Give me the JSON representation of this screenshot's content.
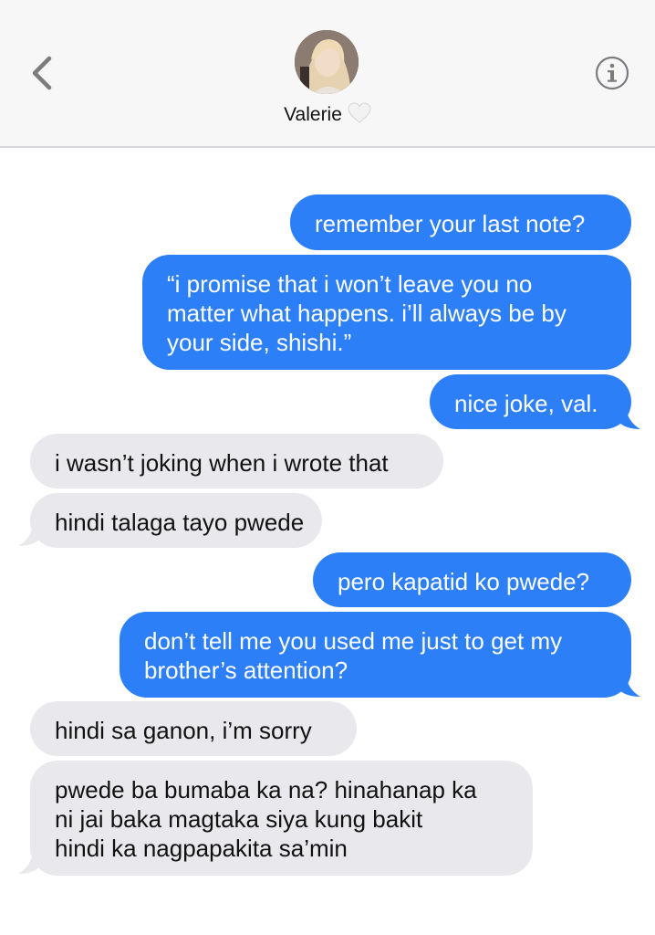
{
  "header": {
    "contact_name": "Valerie",
    "back_icon": "chevron-left-icon",
    "info_icon": "info-icon",
    "heart_icon": "white-heart-icon"
  },
  "colors": {
    "sent_bubble": "#2d7ff7",
    "received_bubble": "#e9e9ed",
    "accent": "#2d7ff7"
  },
  "messages": [
    {
      "direction": "sent",
      "lines": [
        "remember your last note?"
      ]
    },
    {
      "direction": "sent",
      "lines": [
        "“i promise that i won’t leave you no",
        "matter what happens. i’ll always be by",
        "your side, shishi.”"
      ]
    },
    {
      "direction": "sent",
      "lines": [
        "nice joke, val."
      ]
    },
    {
      "direction": "received",
      "lines": [
        "i wasn’t joking when i wrote that"
      ]
    },
    {
      "direction": "received",
      "lines": [
        "hindi talaga tayo pwede"
      ]
    },
    {
      "direction": "sent",
      "lines": [
        "pero kapatid ko pwede?"
      ]
    },
    {
      "direction": "sent",
      "lines": [
        "don’t tell me you used me just to get my",
        "brother’s attention?"
      ]
    },
    {
      "direction": "received",
      "lines": [
        "hindi sa ganon, i’m sorry"
      ]
    },
    {
      "direction": "received",
      "lines": [
        "pwede ba bumaba ka na? hinahanap ka",
        "ni jai baka magtaka siya kung bakit",
        "hindi ka nagpapakita sa’min"
      ]
    }
  ]
}
